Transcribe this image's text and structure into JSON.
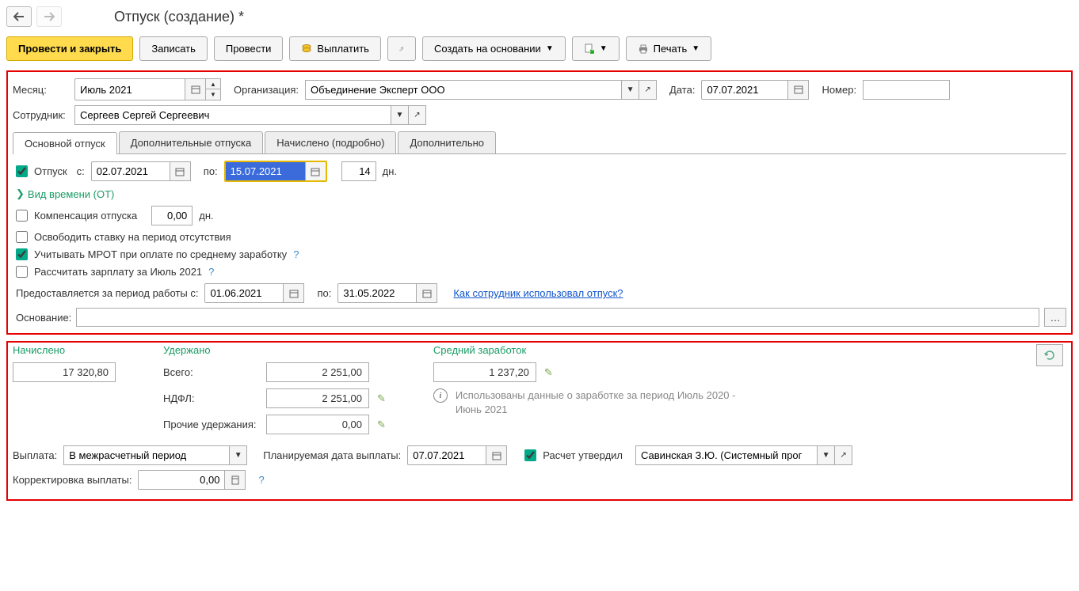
{
  "title": "Отпуск (создание) *",
  "toolbar": {
    "post_close": "Провести и закрыть",
    "save": "Записать",
    "post": "Провести",
    "pay": "Выплатить",
    "create_based": "Создать на основании",
    "print": "Печать"
  },
  "header": {
    "month_label": "Месяц:",
    "month_value": "Июль 2021",
    "org_label": "Организация:",
    "org_value": "Объединение Эксперт ООО",
    "date_label": "Дата:",
    "date_value": "07.07.2021",
    "number_label": "Номер:",
    "number_value": "",
    "employee_label": "Сотрудник:",
    "employee_value": "Сергеев Сергей Сергеевич"
  },
  "tabs": [
    "Основной отпуск",
    "Дополнительные отпуска",
    "Начислено (подробно)",
    "Дополнительно"
  ],
  "main_tab": {
    "vacation_chk": "Отпуск",
    "from_label": "с:",
    "from_value": "02.07.2021",
    "to_label": "по:",
    "to_value": "15.07.2021",
    "days_value": "14",
    "days_label": "дн.",
    "time_type": "Вид времени (ОТ)",
    "compensation": "Компенсация отпуска",
    "comp_value": "0,00",
    "comp_unit": "дн.",
    "free_rate": "Освободить ставку на период отсутствия",
    "mrot": "Учитывать МРОТ при оплате по среднему заработку",
    "calc_salary": "Рассчитать зарплату за Июль 2021",
    "period_label": "Предоставляется за период работы с:",
    "period_from": "01.06.2021",
    "period_to_label": "по:",
    "period_to": "31.05.2022",
    "how_used_link": "Как сотрудник использовал отпуск?",
    "basis_label": "Основание:"
  },
  "summary": {
    "accrued_label": "Начислено",
    "accrued_value": "17 320,80",
    "withheld_label": "Удержано",
    "total_label": "Всего:",
    "total_value": "2 251,00",
    "ndfl_label": "НДФЛ:",
    "ndfl_value": "2 251,00",
    "other_label": "Прочие удержания:",
    "other_value": "0,00",
    "avg_label": "Средний заработок",
    "avg_value": "1 237,20",
    "note": "Использованы данные о заработке за период Июль 2020 - Июнь 2021",
    "payout_label": "Выплата:",
    "payout_value": "В межрасчетный период",
    "plan_date_label": "Планируемая дата выплаты:",
    "plan_date_value": "07.07.2021",
    "approved_label": "Расчет утвердил",
    "approver_value": "Савинская З.Ю. (Системный прог",
    "correction_label": "Корректировка выплаты:",
    "correction_value": "0,00"
  }
}
